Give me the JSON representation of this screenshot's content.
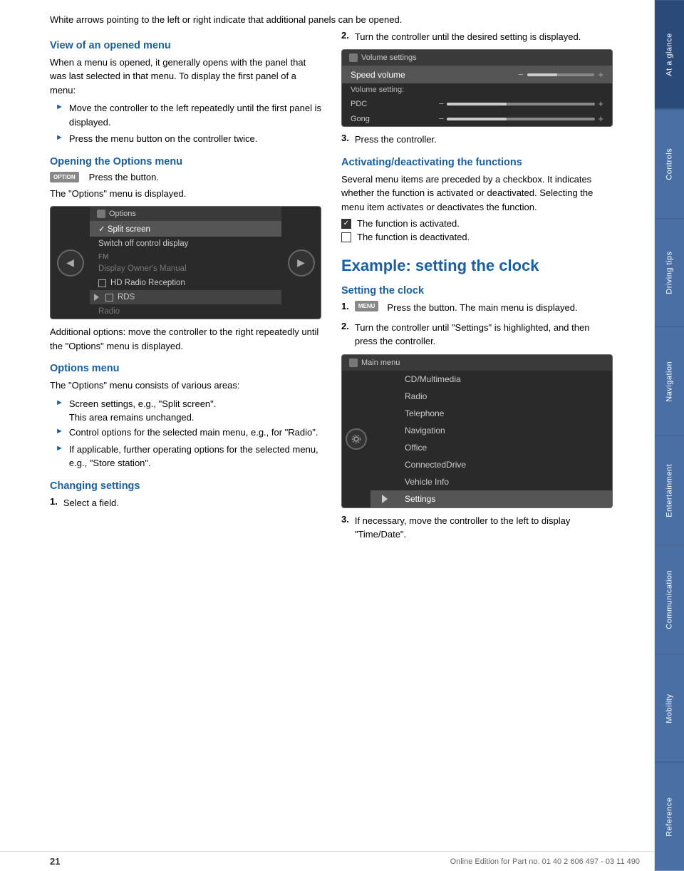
{
  "page": {
    "page_number": "21",
    "bottom_text": "Online Edition for Part no. 01 40 2 606 497 - 03 11 490"
  },
  "sidebar": {
    "tabs": [
      {
        "id": "at-a-glance",
        "label": "At a glance",
        "active": true
      },
      {
        "id": "controls",
        "label": "Controls",
        "active": false
      },
      {
        "id": "driving-tips",
        "label": "Driving tips",
        "active": false
      },
      {
        "id": "navigation",
        "label": "Navigation",
        "active": false
      },
      {
        "id": "entertainment",
        "label": "Entertainment",
        "active": false
      },
      {
        "id": "communication",
        "label": "Communication",
        "active": false
      },
      {
        "id": "mobility",
        "label": "Mobility",
        "active": false
      },
      {
        "id": "reference",
        "label": "Reference",
        "active": false
      }
    ]
  },
  "intro": {
    "text": "White arrows pointing to the left or right indicate that additional panels can be opened."
  },
  "section_opened_menu": {
    "title": "View of an opened menu",
    "body": "When a menu is opened, it generally opens with the panel that was last selected in that menu. To display the first panel of a menu:",
    "bullets": [
      "Move the controller to the left repeatedly until the first panel is displayed.",
      "Press the menu button on the controller twice."
    ]
  },
  "section_options_menu_heading": {
    "title": "Opening the Options menu",
    "button_label": "OPTION",
    "desc": "Press the button.",
    "displayed_text": "The \"Options\" menu is displayed.",
    "additional_text": "Additional options: move the controller to the right repeatedly until the \"Options\" menu is displayed."
  },
  "options_screen": {
    "title": "Options",
    "title_icon": "gear",
    "items": [
      {
        "text": "Split screen",
        "type": "checked",
        "selected": true
      },
      {
        "text": "Switch off control display",
        "type": "normal",
        "grayed": false
      },
      {
        "text": "FM",
        "type": "section"
      },
      {
        "text": "Display Owner's Manual",
        "type": "normal",
        "grayed": true
      },
      {
        "text": "HD Radio Reception",
        "type": "checkbox",
        "checked": false
      },
      {
        "text": "RDS",
        "type": "normal",
        "highlighted": true
      },
      {
        "text": "Radio",
        "type": "normal",
        "grayed": true
      }
    ]
  },
  "section_options_menu": {
    "title": "Options menu",
    "body": "The \"Options\" menu consists of various areas:",
    "bullets": [
      {
        "text": "Screen settings, e.g., \"Split screen\".",
        "sub": "This area remains unchanged."
      },
      {
        "text": "Control options for the selected main menu, e.g., for \"Radio\"."
      },
      {
        "text": "If applicable, further operating options for the selected menu, e.g., \"Store station\"."
      }
    ]
  },
  "section_changing_settings": {
    "title": "Changing settings",
    "step1": "Select a field."
  },
  "right_col": {
    "step2_text": "Turn the controller until the desired setting is displayed.",
    "step3_text": "Press the controller.",
    "volume_screen": {
      "title": "Volume settings",
      "title_icon": "speaker",
      "selected_item": "Speed volume",
      "label": "Volume setting:",
      "rows": [
        {
          "label": "PDC",
          "slider_pct": 40
        },
        {
          "label": "Gong",
          "slider_pct": 40
        }
      ]
    },
    "section_activating": {
      "title": "Activating/deactivating the functions",
      "body": "Several menu items are preceded by a checkbox. It indicates whether the function is activated or deactivated. Selecting the menu item activates or deactivates the function.",
      "activated_text": "The function is activated.",
      "deactivated_text": "The function is deactivated."
    },
    "section_example": {
      "title": "Example: setting the clock",
      "subtitle": "Setting the clock",
      "step1_text": "Press the button. The main menu is displayed.",
      "step2_text": "Turn the controller until \"Settings\" is highlighted, and then press the controller.",
      "step3_text": "If necessary, move the controller to the left to display \"Time/Date\".",
      "menu_button_label": "MENU",
      "main_menu_title": "Main menu",
      "main_menu_items": [
        "CD/Multimedia",
        "Radio",
        "Telephone",
        "Navigation",
        "Office",
        "ConnectedDrive",
        "Vehicle Info",
        "Settings"
      ]
    }
  }
}
